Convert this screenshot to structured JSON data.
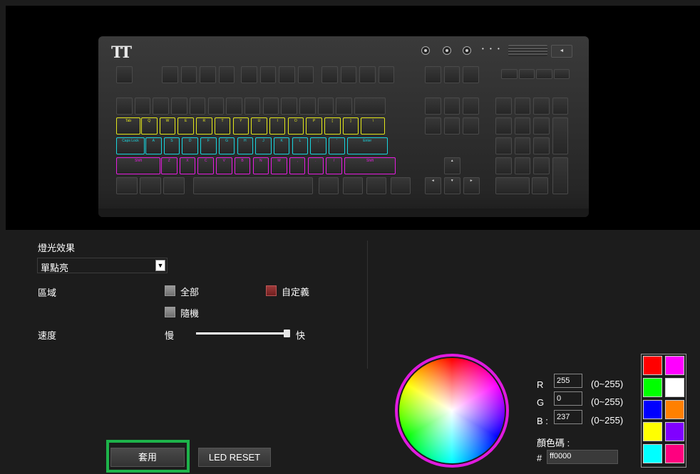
{
  "effect": {
    "title": "燈光效果",
    "selected": "單點亮"
  },
  "region": {
    "label": "區域",
    "options": [
      {
        "label": "全部",
        "checked": false
      },
      {
        "label": "自定義",
        "checked": true
      },
      {
        "label": "隨機",
        "checked": false
      }
    ]
  },
  "speed": {
    "label": "速度",
    "slow": "慢",
    "fast": "快",
    "value": 1.0
  },
  "buttons": {
    "apply": "套用",
    "reset": "LED RESET"
  },
  "color": {
    "r_label": "R",
    "g_label": "G",
    "b_label": "B :",
    "r": "255",
    "g": "0",
    "b": "237",
    "r_range": "(0~255)",
    "g_range": "(0~255)",
    "b_range": "(0~255)",
    "code_label": "顏色碼 :",
    "hash": "#",
    "code": "ff0000",
    "ring": "#e01adf"
  },
  "swatches": [
    "#ff0000",
    "#ff00ff",
    "#00ff00",
    "#ffffff",
    "#0000ff",
    "#ff8000",
    "#ffff00",
    "#8000ff",
    "#00ffff",
    "#ff007f"
  ],
  "keyboard": {
    "brand_logo": "TT",
    "row_colors": {
      "q_row": "#e3e61b",
      "a_row": "#19d6e0",
      "z_row": "#e61ee0"
    },
    "keys": {
      "q_row": [
        "Tab",
        "Q",
        "W",
        "E",
        "R",
        "T",
        "Y",
        "U",
        "I",
        "O",
        "P",
        "[",
        "]",
        "\\"
      ],
      "a_row": [
        "Caps Lock",
        "A",
        "S",
        "D",
        "F",
        "G",
        "H",
        "J",
        "K",
        "L",
        ";",
        "'",
        "Enter"
      ],
      "z_row": [
        "Shift",
        "Z",
        "X",
        "C",
        "V",
        "B",
        "N",
        "M",
        ",",
        ".",
        "/",
        "Shift"
      ]
    }
  }
}
